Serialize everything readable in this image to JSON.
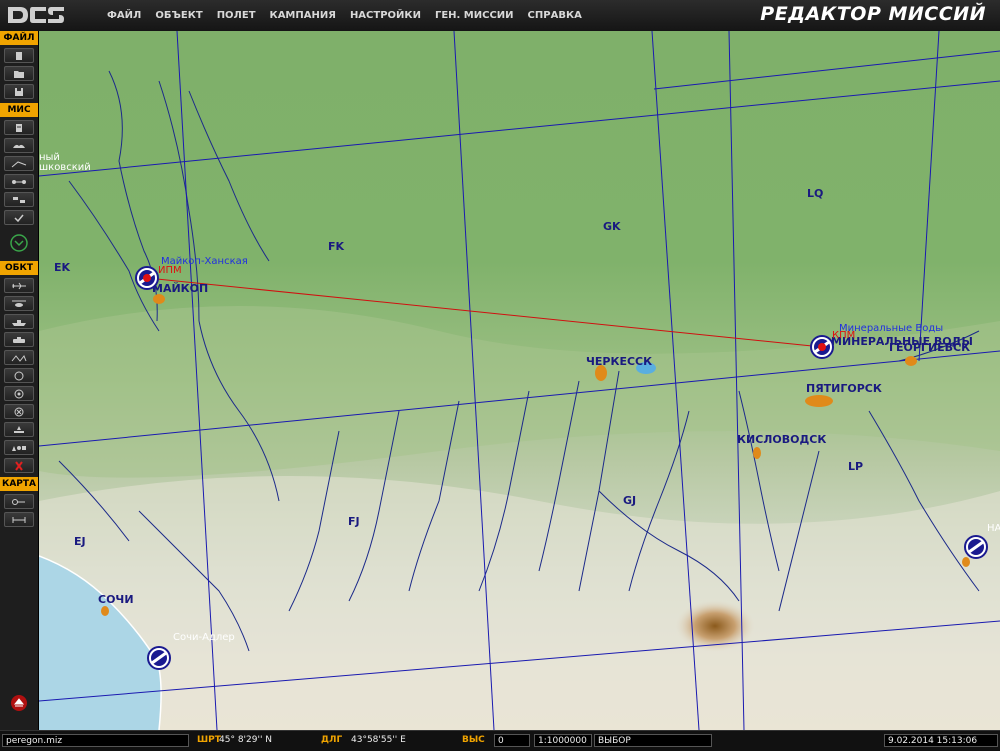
{
  "app": {
    "title": "РЕДАКТОР МИССИЙ",
    "menu": [
      "ФАЙЛ",
      "ОБЪЕКТ",
      "ПОЛЕТ",
      "КАМПАНИЯ",
      "НАСТРОЙКИ",
      "ГЕН. МИССИИ",
      "СПРАВКА"
    ]
  },
  "toolbar": {
    "sections": {
      "file": "ФАЙЛ",
      "mission": "МИС",
      "objects": "ОБКТ",
      "map": "КАРТА"
    }
  },
  "map": {
    "grid_labels": [
      "EK",
      "FK",
      "GK",
      "LQ",
      "EJ",
      "FJ",
      "GJ",
      "LP"
    ],
    "cities": [
      "МАЙКОП",
      "ЧЕРКЕССК",
      "МИНЕРАЛЬНЫЕ ВОДЫ",
      "ГЕОРГИЕВСК",
      "ПЯТИГОРСК",
      "КИСЛОВОДСК",
      "СОЧИ"
    ],
    "airfields": [
      "Майкоп-Ханская",
      "Минеральные Воды",
      "Сочи-Адлер",
      "НА"
    ],
    "waypoint_labels": [
      "ИПМ",
      "КПМ"
    ],
    "edge_labels": [
      "ный",
      "шковский"
    ],
    "route_color": "#d01010"
  },
  "status": {
    "filename": "peregon.miz",
    "lat_label": "ШРТ",
    "lat_value": "45° 8'29'' N",
    "lon_label": "ДЛГ",
    "lon_value": "43°58'55'' E",
    "alt_label": "ВЫС",
    "alt_value": "0",
    "scale": "1:1000000",
    "mode": "ВЫБОР",
    "datetime": "9.02.2014 15:13:06"
  }
}
